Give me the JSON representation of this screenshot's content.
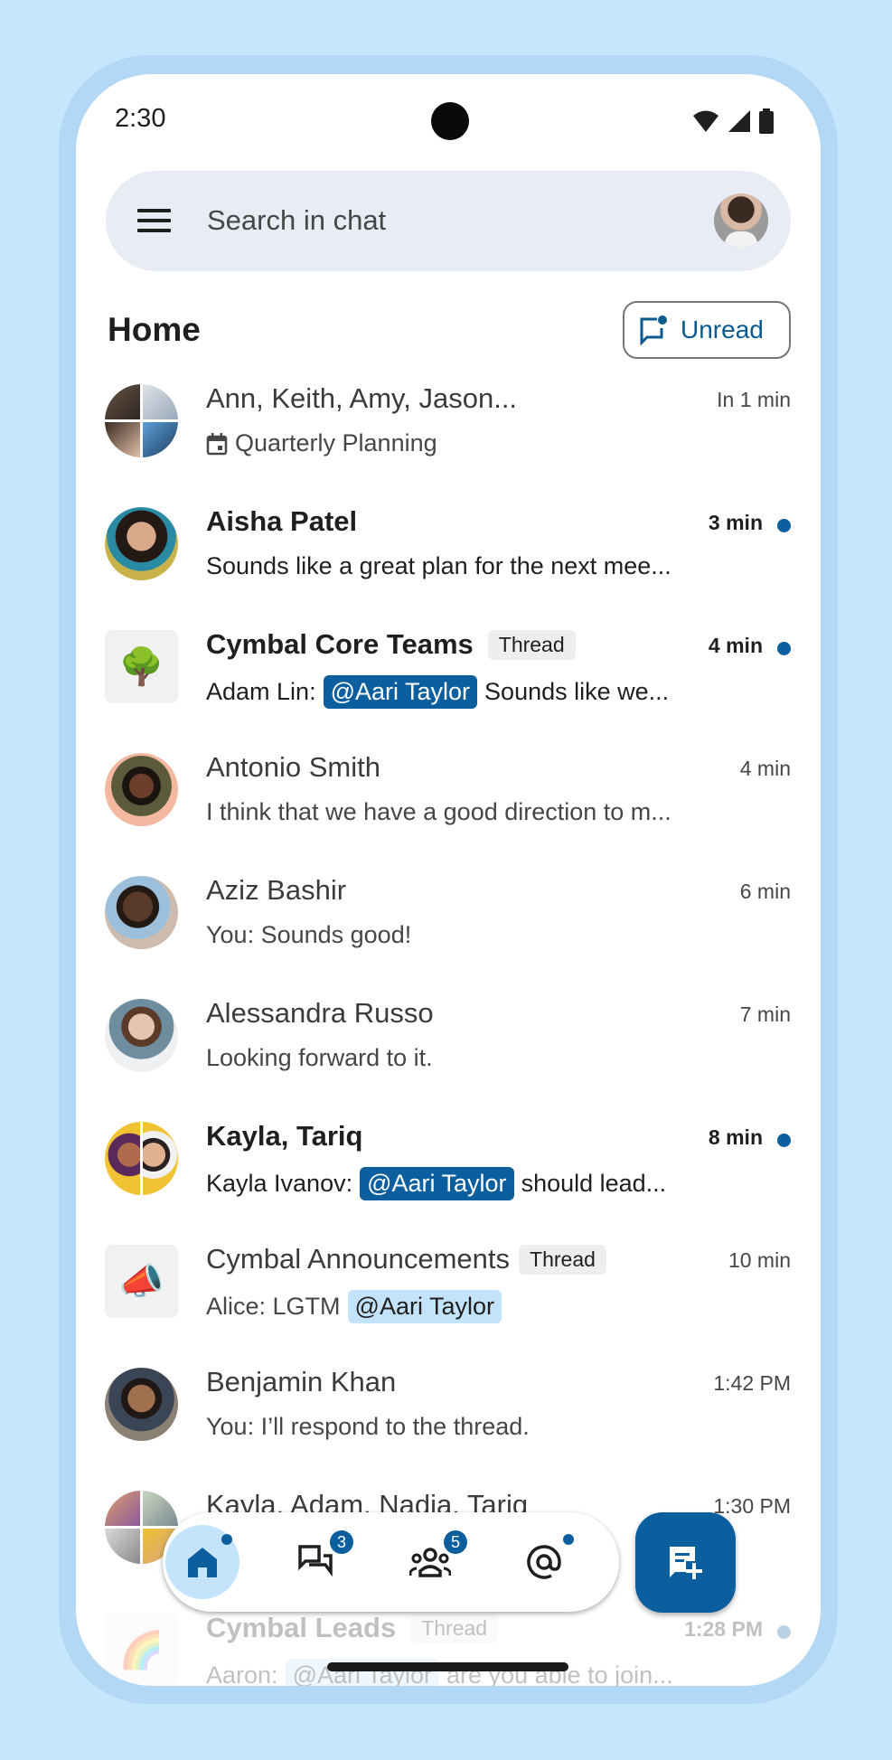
{
  "status_bar": {
    "time": "2:30",
    "icons": [
      "wifi-icon",
      "signal-icon",
      "battery-icon"
    ]
  },
  "search": {
    "placeholder": "Search in chat",
    "value": ""
  },
  "header": {
    "title": "Home",
    "unread_label": "Unread"
  },
  "colors": {
    "accent": "#0b5f9e",
    "background": "#c6e6fd",
    "frame": "#b3d8f6",
    "search_bg": "#e8ecf4",
    "active_nav": "#c3e4fb",
    "mention_light": "#c3e3fb"
  },
  "conversations": [
    {
      "name": "Ann, Keith, Amy, Jason...",
      "time": "In 1 min",
      "preview_prefix": "",
      "mention": "",
      "preview": "Quarterly Planning",
      "preview_icon": "calendar-icon",
      "unread": false,
      "bold": false,
      "thread": false,
      "avatar": "group-quad"
    },
    {
      "name": "Aisha Patel",
      "time": "3 min",
      "preview_prefix": "",
      "mention": "",
      "preview": "Sounds like a great plan for the next mee...",
      "unread": true,
      "bold": true,
      "thread": false,
      "avatar": "photo"
    },
    {
      "name": "Cymbal Core Teams",
      "thread_label": "Thread",
      "time": "4 min",
      "preview_prefix": "Adam Lin:",
      "mention": "@Aari Taylor",
      "preview": "Sounds like we...",
      "unread": true,
      "bold": true,
      "thread": true,
      "avatar": "tree-emoji"
    },
    {
      "name": "Antonio Smith",
      "time": "4 min",
      "preview_prefix": "",
      "mention": "",
      "preview": "I think that we have a good direction to m...",
      "unread": false,
      "bold": false,
      "thread": false,
      "avatar": "photo"
    },
    {
      "name": "Aziz Bashir",
      "time": "6 min",
      "preview_prefix": "",
      "mention": "",
      "preview": "You: Sounds good!",
      "unread": false,
      "bold": false,
      "thread": false,
      "avatar": "photo"
    },
    {
      "name": "Alessandra Russo",
      "time": "7 min",
      "preview_prefix": "",
      "mention": "",
      "preview": "Looking forward to it.",
      "unread": false,
      "bold": false,
      "thread": false,
      "avatar": "photo"
    },
    {
      "name": "Kayla, Tariq",
      "time": "8 min",
      "preview_prefix": "Kayla Ivanov:",
      "mention": "@Aari Taylor",
      "preview": "should lead...",
      "unread": true,
      "bold": true,
      "thread": false,
      "avatar": "group-half"
    },
    {
      "name": "Cymbal Announcements",
      "thread_label": "Thread",
      "time": "10 min",
      "preview_prefix": "Alice: LGTM",
      "mention": "@Aari Taylor",
      "preview": "",
      "unread": false,
      "bold": false,
      "thread": true,
      "avatar": "megaphone-emoji",
      "mention_style": "light"
    },
    {
      "name": "Benjamin Khan",
      "time": "1:42 PM",
      "preview_prefix": "",
      "mention": "",
      "preview": "You: I’ll respond to the thread.",
      "unread": false,
      "bold": false,
      "thread": false,
      "avatar": "photo"
    },
    {
      "name": "Kayla, Adam, Nadia, Tariq",
      "time": "1:30 PM",
      "preview_prefix": "",
      "mention": "",
      "preview": "",
      "unread": false,
      "bold": false,
      "thread": false,
      "avatar": "group-quad"
    },
    {
      "name": "Cymbal Leads",
      "thread_label": "Thread",
      "time": "1:28 PM",
      "preview_prefix": "Aaron:",
      "mention": "@Aari Taylor",
      "preview": "are you able to join...",
      "unread": true,
      "bold": true,
      "thread": true,
      "avatar": "rainbow-emoji"
    }
  ],
  "nav": {
    "items": [
      {
        "name": "home",
        "icon": "home-icon",
        "active": true,
        "dot": true,
        "badge": ""
      },
      {
        "name": "chats",
        "icon": "chat-bubbles-icon",
        "active": false,
        "dot": false,
        "badge": "3"
      },
      {
        "name": "spaces",
        "icon": "people-icon",
        "active": false,
        "dot": false,
        "badge": "5"
      },
      {
        "name": "mentions",
        "icon": "at-icon",
        "active": false,
        "dot": true,
        "badge": ""
      }
    ],
    "fab_icon": "new-chat-icon"
  }
}
